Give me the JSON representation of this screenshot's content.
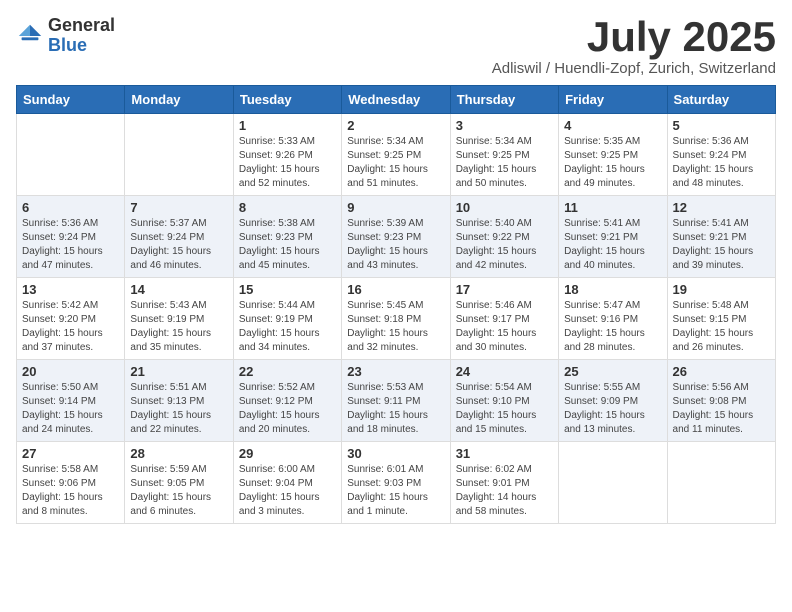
{
  "header": {
    "logo_general": "General",
    "logo_blue": "Blue",
    "month_title": "July 2025",
    "location": "Adliswil / Huendli-Zopf, Zurich, Switzerland"
  },
  "days_of_week": [
    "Sunday",
    "Monday",
    "Tuesday",
    "Wednesday",
    "Thursday",
    "Friday",
    "Saturday"
  ],
  "weeks": [
    [
      {
        "day": "",
        "sunrise": "",
        "sunset": "",
        "daylight": ""
      },
      {
        "day": "",
        "sunrise": "",
        "sunset": "",
        "daylight": ""
      },
      {
        "day": "1",
        "sunrise": "Sunrise: 5:33 AM",
        "sunset": "Sunset: 9:26 PM",
        "daylight": "Daylight: 15 hours and 52 minutes."
      },
      {
        "day": "2",
        "sunrise": "Sunrise: 5:34 AM",
        "sunset": "Sunset: 9:25 PM",
        "daylight": "Daylight: 15 hours and 51 minutes."
      },
      {
        "day": "3",
        "sunrise": "Sunrise: 5:34 AM",
        "sunset": "Sunset: 9:25 PM",
        "daylight": "Daylight: 15 hours and 50 minutes."
      },
      {
        "day": "4",
        "sunrise": "Sunrise: 5:35 AM",
        "sunset": "Sunset: 9:25 PM",
        "daylight": "Daylight: 15 hours and 49 minutes."
      },
      {
        "day": "5",
        "sunrise": "Sunrise: 5:36 AM",
        "sunset": "Sunset: 9:24 PM",
        "daylight": "Daylight: 15 hours and 48 minutes."
      }
    ],
    [
      {
        "day": "6",
        "sunrise": "Sunrise: 5:36 AM",
        "sunset": "Sunset: 9:24 PM",
        "daylight": "Daylight: 15 hours and 47 minutes."
      },
      {
        "day": "7",
        "sunrise": "Sunrise: 5:37 AM",
        "sunset": "Sunset: 9:24 PM",
        "daylight": "Daylight: 15 hours and 46 minutes."
      },
      {
        "day": "8",
        "sunrise": "Sunrise: 5:38 AM",
        "sunset": "Sunset: 9:23 PM",
        "daylight": "Daylight: 15 hours and 45 minutes."
      },
      {
        "day": "9",
        "sunrise": "Sunrise: 5:39 AM",
        "sunset": "Sunset: 9:23 PM",
        "daylight": "Daylight: 15 hours and 43 minutes."
      },
      {
        "day": "10",
        "sunrise": "Sunrise: 5:40 AM",
        "sunset": "Sunset: 9:22 PM",
        "daylight": "Daylight: 15 hours and 42 minutes."
      },
      {
        "day": "11",
        "sunrise": "Sunrise: 5:41 AM",
        "sunset": "Sunset: 9:21 PM",
        "daylight": "Daylight: 15 hours and 40 minutes."
      },
      {
        "day": "12",
        "sunrise": "Sunrise: 5:41 AM",
        "sunset": "Sunset: 9:21 PM",
        "daylight": "Daylight: 15 hours and 39 minutes."
      }
    ],
    [
      {
        "day": "13",
        "sunrise": "Sunrise: 5:42 AM",
        "sunset": "Sunset: 9:20 PM",
        "daylight": "Daylight: 15 hours and 37 minutes."
      },
      {
        "day": "14",
        "sunrise": "Sunrise: 5:43 AM",
        "sunset": "Sunset: 9:19 PM",
        "daylight": "Daylight: 15 hours and 35 minutes."
      },
      {
        "day": "15",
        "sunrise": "Sunrise: 5:44 AM",
        "sunset": "Sunset: 9:19 PM",
        "daylight": "Daylight: 15 hours and 34 minutes."
      },
      {
        "day": "16",
        "sunrise": "Sunrise: 5:45 AM",
        "sunset": "Sunset: 9:18 PM",
        "daylight": "Daylight: 15 hours and 32 minutes."
      },
      {
        "day": "17",
        "sunrise": "Sunrise: 5:46 AM",
        "sunset": "Sunset: 9:17 PM",
        "daylight": "Daylight: 15 hours and 30 minutes."
      },
      {
        "day": "18",
        "sunrise": "Sunrise: 5:47 AM",
        "sunset": "Sunset: 9:16 PM",
        "daylight": "Daylight: 15 hours and 28 minutes."
      },
      {
        "day": "19",
        "sunrise": "Sunrise: 5:48 AM",
        "sunset": "Sunset: 9:15 PM",
        "daylight": "Daylight: 15 hours and 26 minutes."
      }
    ],
    [
      {
        "day": "20",
        "sunrise": "Sunrise: 5:50 AM",
        "sunset": "Sunset: 9:14 PM",
        "daylight": "Daylight: 15 hours and 24 minutes."
      },
      {
        "day": "21",
        "sunrise": "Sunrise: 5:51 AM",
        "sunset": "Sunset: 9:13 PM",
        "daylight": "Daylight: 15 hours and 22 minutes."
      },
      {
        "day": "22",
        "sunrise": "Sunrise: 5:52 AM",
        "sunset": "Sunset: 9:12 PM",
        "daylight": "Daylight: 15 hours and 20 minutes."
      },
      {
        "day": "23",
        "sunrise": "Sunrise: 5:53 AM",
        "sunset": "Sunset: 9:11 PM",
        "daylight": "Daylight: 15 hours and 18 minutes."
      },
      {
        "day": "24",
        "sunrise": "Sunrise: 5:54 AM",
        "sunset": "Sunset: 9:10 PM",
        "daylight": "Daylight: 15 hours and 15 minutes."
      },
      {
        "day": "25",
        "sunrise": "Sunrise: 5:55 AM",
        "sunset": "Sunset: 9:09 PM",
        "daylight": "Daylight: 15 hours and 13 minutes."
      },
      {
        "day": "26",
        "sunrise": "Sunrise: 5:56 AM",
        "sunset": "Sunset: 9:08 PM",
        "daylight": "Daylight: 15 hours and 11 minutes."
      }
    ],
    [
      {
        "day": "27",
        "sunrise": "Sunrise: 5:58 AM",
        "sunset": "Sunset: 9:06 PM",
        "daylight": "Daylight: 15 hours and 8 minutes."
      },
      {
        "day": "28",
        "sunrise": "Sunrise: 5:59 AM",
        "sunset": "Sunset: 9:05 PM",
        "daylight": "Daylight: 15 hours and 6 minutes."
      },
      {
        "day": "29",
        "sunrise": "Sunrise: 6:00 AM",
        "sunset": "Sunset: 9:04 PM",
        "daylight": "Daylight: 15 hours and 3 minutes."
      },
      {
        "day": "30",
        "sunrise": "Sunrise: 6:01 AM",
        "sunset": "Sunset: 9:03 PM",
        "daylight": "Daylight: 15 hours and 1 minute."
      },
      {
        "day": "31",
        "sunrise": "Sunrise: 6:02 AM",
        "sunset": "Sunset: 9:01 PM",
        "daylight": "Daylight: 14 hours and 58 minutes."
      },
      {
        "day": "",
        "sunrise": "",
        "sunset": "",
        "daylight": ""
      },
      {
        "day": "",
        "sunrise": "",
        "sunset": "",
        "daylight": ""
      }
    ]
  ]
}
